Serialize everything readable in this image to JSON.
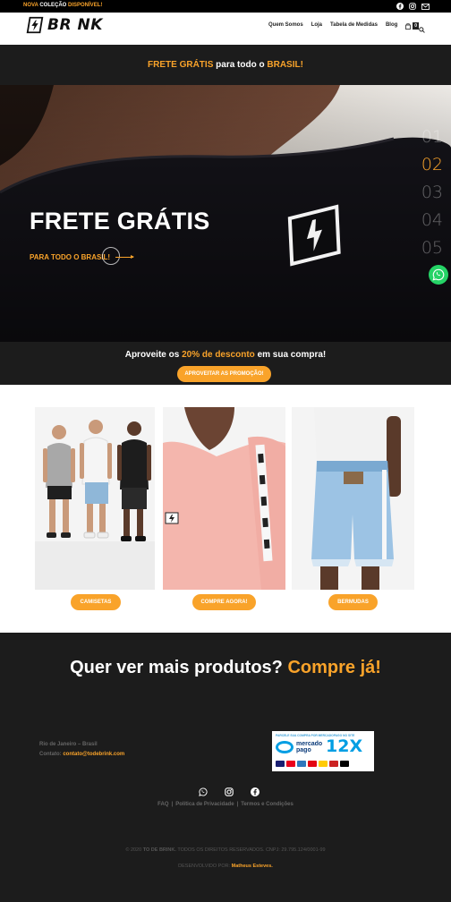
{
  "topbar": {
    "promo_new": "NOVA",
    "promo_mid": "COLEÇÃO",
    "promo_end": "DISPONÍVEL!",
    "social_icons": [
      "facebook-icon",
      "instagram-icon",
      "mail-icon"
    ]
  },
  "header": {
    "logo_text": "BR NK",
    "nav": [
      "Quem Somos",
      "Loja",
      "Tabela de Medidas",
      "Blog"
    ],
    "cart_count": "0"
  },
  "banner": {
    "part1": "FRETE GRÁTIS",
    "part2": "para todo o",
    "part3": "BRASIL!"
  },
  "hero": {
    "headline": "FRETE GRÁTIS",
    "cta": "PARA TODO O BRASIL!",
    "slides": [
      "01",
      "02",
      "03",
      "04",
      "05"
    ],
    "active_slide": "02"
  },
  "promo": {
    "text1": "Aproveite os",
    "highlight": "20% de desconto",
    "text2": "em sua compra!",
    "button": "APROVEITAR AS PROMOÇÃO!"
  },
  "products": [
    {
      "label": "CAMISETAS"
    },
    {
      "label": "COMPRE AGORA!"
    },
    {
      "label": "BERMUDAS"
    }
  ],
  "cta2": {
    "text1": "Quer ver mais produtos?",
    "text2": "Compre já!"
  },
  "footer": {
    "location": "Rio de Janeiro – Brasil",
    "contact_label": "Contato:",
    "contact_email": "contato@todebrink.com",
    "payment": {
      "top_text": "PARCELE SUA COMPRA POR MERCADOPAGO NO SITE",
      "brand_line1": "mercado",
      "brand_line2": "pago",
      "installments": "12X"
    },
    "links": [
      "FAQ",
      "Política de Privacidade",
      "Termos e Condições"
    ],
    "copyright_year": "© 2020",
    "copyright_brand": "TO DE BRINK.",
    "copyright_rest": "TODOS OS DIREITOS RESERVADOS. CNPJ: 29.795.124/0001-99",
    "dev_label": "DESENVOLVIDO POR:",
    "dev_name": "Matheus Esteves."
  },
  "colors": {
    "accent": "#f9a32a",
    "dark": "#1c1c1c",
    "whatsapp": "#25d366"
  }
}
